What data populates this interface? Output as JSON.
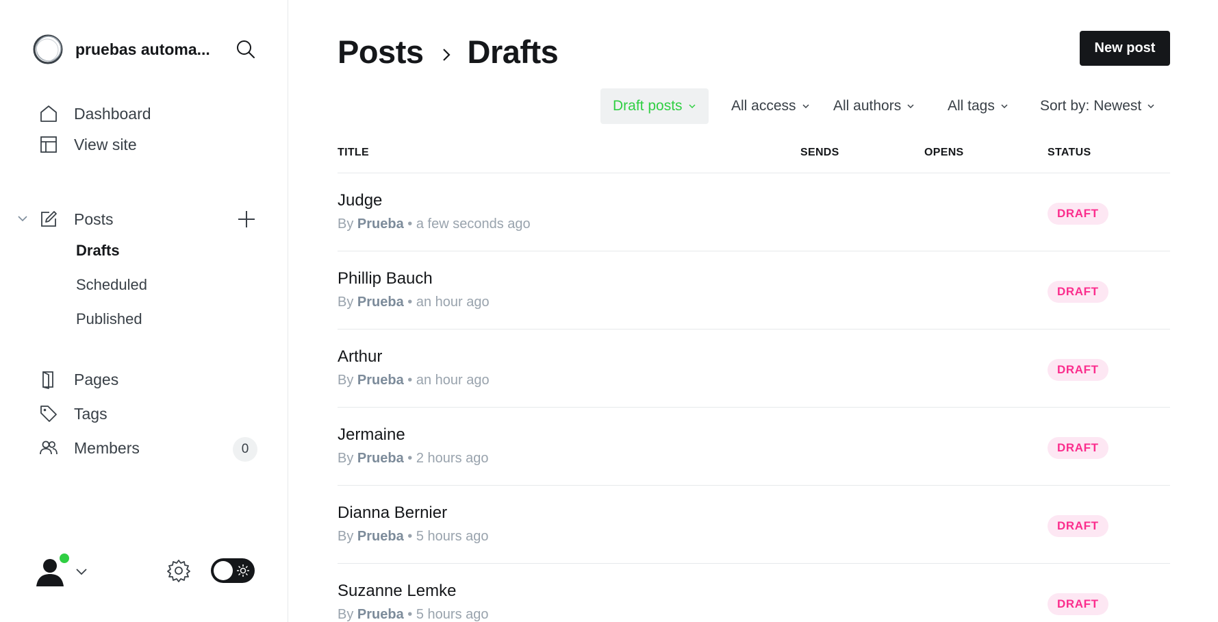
{
  "sidebar": {
    "site_name": "pruebas automa...",
    "nav": [
      {
        "label": "Dashboard",
        "icon": "home-icon"
      },
      {
        "label": "View site",
        "icon": "layout-icon"
      }
    ],
    "posts": {
      "label": "Posts",
      "icon": "edit-icon",
      "sub_items": [
        {
          "label": "Drafts",
          "active": true
        },
        {
          "label": "Scheduled",
          "active": false
        },
        {
          "label": "Published",
          "active": false
        }
      ]
    },
    "pages_label": "Pages",
    "tags_label": "Tags",
    "members_label": "Members",
    "members_count": "0"
  },
  "header": {
    "breadcrumb_parent": "Posts",
    "breadcrumb_current": "Drafts",
    "new_post_label": "New post"
  },
  "filters": {
    "type": "Draft posts",
    "access": "All access",
    "authors": "All authors",
    "tags": "All tags",
    "sort": "Sort by: Newest"
  },
  "table": {
    "columns": [
      "TITLE",
      "SENDS",
      "OPENS",
      "STATUS"
    ],
    "rows": [
      {
        "title": "Judge",
        "by": "By",
        "author": "Prueba",
        "sep": "•",
        "time": "a few seconds ago",
        "status": "DRAFT"
      },
      {
        "title": "Phillip Bauch",
        "by": "By",
        "author": "Prueba",
        "sep": "•",
        "time": "an hour ago",
        "status": "DRAFT"
      },
      {
        "title": "Arthur",
        "by": "By",
        "author": "Prueba",
        "sep": "•",
        "time": "an hour ago",
        "status": "DRAFT"
      },
      {
        "title": "Jermaine",
        "by": "By",
        "author": "Prueba",
        "sep": "•",
        "time": "2 hours ago",
        "status": "DRAFT"
      },
      {
        "title": "Dianna Bernier",
        "by": "By",
        "author": "Prueba",
        "sep": "•",
        "time": "5 hours ago",
        "status": "DRAFT"
      },
      {
        "title": "Suzanne Lemke",
        "by": "By",
        "author": "Prueba",
        "sep": "•",
        "time": "5 hours ago",
        "status": "DRAFT"
      }
    ]
  },
  "colors": {
    "accent_green": "#30cf43",
    "draft_pink": "#fb2d8d",
    "draft_pink_bg": "#fde7f3",
    "dark": "#15171a"
  }
}
